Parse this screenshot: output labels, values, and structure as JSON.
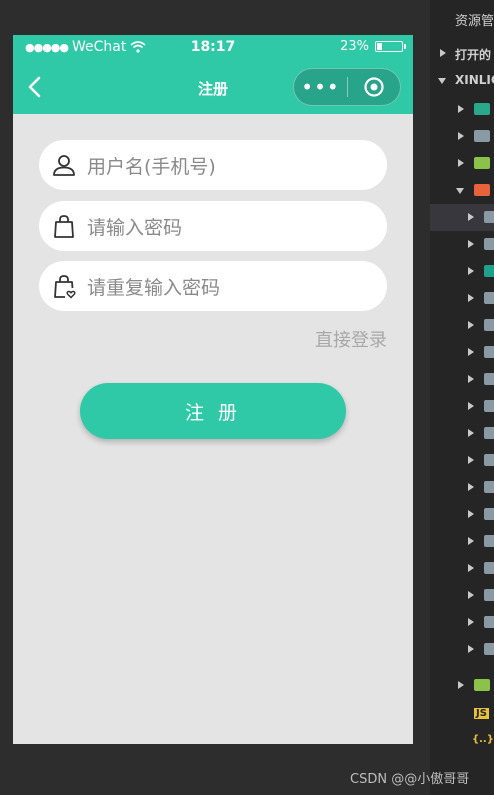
{
  "status_bar": {
    "signal": "●●●●●",
    "carrier": "WeChat",
    "time": "18:17",
    "battery_text": "23%",
    "battery_level": 0.23
  },
  "nav": {
    "title": "注册",
    "more": "•••"
  },
  "form": {
    "username_placeholder": "用户名(手机号)",
    "password_placeholder": "请输入密码",
    "confirm_placeholder": "请重复输入密码",
    "login_link": "直接登录",
    "submit_label": "注 册"
  },
  "ide": {
    "header": "资源管",
    "open_editors": "打开的",
    "project": "XINLIC",
    "js_label": "JS",
    "json_label": "{..}"
  },
  "watermark": "CSDN @@小傲哥哥",
  "colors": {
    "accent": "#30c9a8",
    "page_bg": "#e4e4e4",
    "ide_bg": "#252526"
  }
}
